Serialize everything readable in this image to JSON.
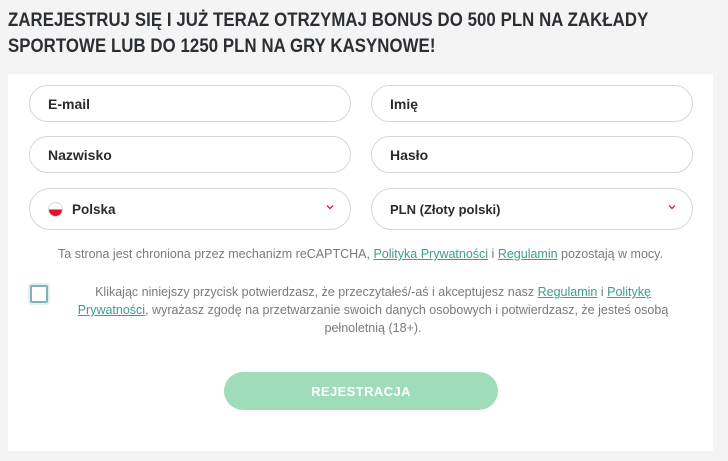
{
  "headline": {
    "line1": "ZAREJESTRUJ SIĘ I JUŻ TERAZ OTRZYMAJ BONUS DO 500 PLN NA ZAKŁADY",
    "line2": "SPORTOWE LUB DO 1250 PLN NA GRY KASYNOWE!"
  },
  "form": {
    "email_placeholder": "E-mail",
    "first_name_placeholder": "Imię",
    "last_name_placeholder": "Nazwisko",
    "password_placeholder": "Hasło",
    "country_value": "Polska",
    "currency_value": "PLN (Złoty polski)"
  },
  "recaptcha": {
    "text_before": "Ta strona jest chroniona przez mechanizm reCAPTCHA, ",
    "privacy_link": "Polityka Prywatności",
    "sep": " i ",
    "terms_link": "Regulamin",
    "text_after": " pozostają w mocy."
  },
  "consent": {
    "text_before": "Klikając niniejszy przycisk potwierdzasz, że przeczytałeś/-aś i akceptujesz nasz ",
    "terms_link": "Regulamin",
    "sep": " i ",
    "privacy_link": "Politykę Prywatności",
    "text_after": ", wyrażasz zgodę na przetwarzanie swoich danych osobowych i potwierdzasz, że jesteś osobą pełnoletnią (18+)."
  },
  "submit_label": "REJESTRACJA",
  "colors": {
    "accent_link": "#3e9d8c",
    "submit_bg": "#9fdcb9",
    "chevron": "#e2213f"
  },
  "icons": {
    "country_flag": "poland-flag-icon",
    "dropdown": "chevron-down-icon"
  }
}
